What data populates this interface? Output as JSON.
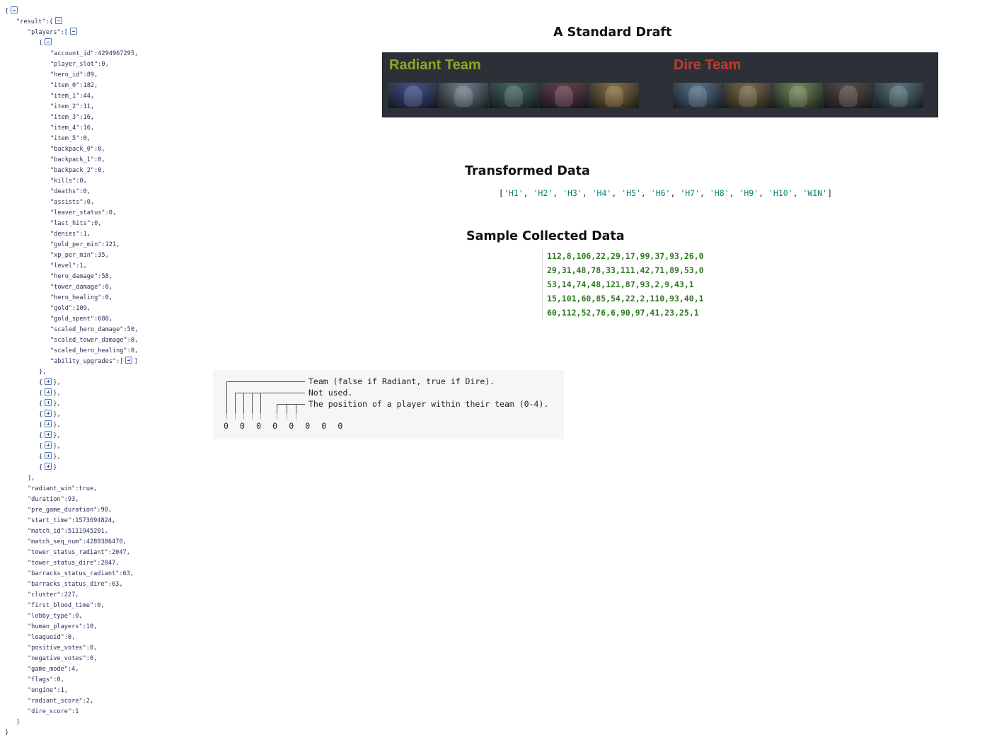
{
  "json_tree": {
    "lines": [
      {
        "indent": 0,
        "text": "{",
        "toggle": "minus"
      },
      {
        "indent": 1,
        "text": "\"result\":{",
        "toggle": "minus"
      },
      {
        "indent": 2,
        "text": "\"players\":[",
        "toggle": "minus"
      },
      {
        "indent": 3,
        "text": "{",
        "toggle": "minus"
      },
      {
        "indent": 4,
        "text": "\"account_id\":4294967295,"
      },
      {
        "indent": 4,
        "text": "\"player_slot\":0,"
      },
      {
        "indent": 4,
        "text": "\"hero_id\":89,"
      },
      {
        "indent": 4,
        "text": "\"item_0\":182,"
      },
      {
        "indent": 4,
        "text": "\"item_1\":44,"
      },
      {
        "indent": 4,
        "text": "\"item_2\":11,"
      },
      {
        "indent": 4,
        "text": "\"item_3\":16,"
      },
      {
        "indent": 4,
        "text": "\"item_4\":16,"
      },
      {
        "indent": 4,
        "text": "\"item_5\":0,"
      },
      {
        "indent": 4,
        "text": "\"backpack_0\":0,"
      },
      {
        "indent": 4,
        "text": "\"backpack_1\":0,"
      },
      {
        "indent": 4,
        "text": "\"backpack_2\":0,"
      },
      {
        "indent": 4,
        "text": "\"kills\":0,"
      },
      {
        "indent": 4,
        "text": "\"deaths\":0,"
      },
      {
        "indent": 4,
        "text": "\"assists\":0,"
      },
      {
        "indent": 4,
        "text": "\"leaver_status\":0,"
      },
      {
        "indent": 4,
        "text": "\"last_hits\":0,"
      },
      {
        "indent": 4,
        "text": "\"denies\":1,"
      },
      {
        "indent": 4,
        "text": "\"gold_per_min\":121,"
      },
      {
        "indent": 4,
        "text": "\"xp_per_min\":35,"
      },
      {
        "indent": 4,
        "text": "\"level\":1,"
      },
      {
        "indent": 4,
        "text": "\"hero_damage\":58,"
      },
      {
        "indent": 4,
        "text": "\"tower_damage\":0,"
      },
      {
        "indent": 4,
        "text": "\"hero_healing\":0,"
      },
      {
        "indent": 4,
        "text": "\"gold\":109,"
      },
      {
        "indent": 4,
        "text": "\"gold_spent\":680,"
      },
      {
        "indent": 4,
        "text": "\"scaled_hero_damage\":50,"
      },
      {
        "indent": 4,
        "text": "\"scaled_tower_damage\":0,"
      },
      {
        "indent": 4,
        "text": "\"scaled_hero_healing\":0,"
      },
      {
        "indent": 4,
        "text": "\"ability_upgrades\":[",
        "toggle": "plus",
        "after": "]"
      },
      {
        "indent": 3,
        "text": "},"
      },
      {
        "indent": 3,
        "text": "{",
        "toggle": "plus",
        "after": "},"
      },
      {
        "indent": 3,
        "text": "{",
        "toggle": "plus",
        "after": "},"
      },
      {
        "indent": 3,
        "text": "{",
        "toggle": "plus",
        "after": "},"
      },
      {
        "indent": 3,
        "text": "{",
        "toggle": "plus",
        "after": "},"
      },
      {
        "indent": 3,
        "text": "{",
        "toggle": "plus",
        "after": "},"
      },
      {
        "indent": 3,
        "text": "{",
        "toggle": "plus",
        "after": "},"
      },
      {
        "indent": 3,
        "text": "{",
        "toggle": "plus",
        "after": "},"
      },
      {
        "indent": 3,
        "text": "{",
        "toggle": "plus",
        "after": "},"
      },
      {
        "indent": 3,
        "text": "{",
        "toggle": "plus",
        "after": "}"
      },
      {
        "indent": 2,
        "text": "],"
      },
      {
        "indent": 2,
        "text": "\"radiant_win\":true,"
      },
      {
        "indent": 2,
        "text": "\"duration\":93,"
      },
      {
        "indent": 2,
        "text": "\"pre_game_duration\":90,"
      },
      {
        "indent": 2,
        "text": "\"start_time\":1573694824,"
      },
      {
        "indent": 2,
        "text": "\"match_id\":5111945201,"
      },
      {
        "indent": 2,
        "text": "\"match_seq_num\":4289306470,"
      },
      {
        "indent": 2,
        "text": "\"tower_status_radiant\":2047,"
      },
      {
        "indent": 2,
        "text": "\"tower_status_dire\":2047,"
      },
      {
        "indent": 2,
        "text": "\"barracks_status_radiant\":63,"
      },
      {
        "indent": 2,
        "text": "\"barracks_status_dire\":63,"
      },
      {
        "indent": 2,
        "text": "\"cluster\":227,"
      },
      {
        "indent": 2,
        "text": "\"first_blood_time\":0,"
      },
      {
        "indent": 2,
        "text": "\"lobby_type\":0,"
      },
      {
        "indent": 2,
        "text": "\"human_players\":10,"
      },
      {
        "indent": 2,
        "text": "\"leagueid\":0,"
      },
      {
        "indent": 2,
        "text": "\"positive_votes\":0,"
      },
      {
        "indent": 2,
        "text": "\"negative_votes\":0,"
      },
      {
        "indent": 2,
        "text": "\"game_mode\":4,"
      },
      {
        "indent": 2,
        "text": "\"flags\":0,"
      },
      {
        "indent": 2,
        "text": "\"engine\":1,"
      },
      {
        "indent": 2,
        "text": "\"radiant_score\":2,"
      },
      {
        "indent": 2,
        "text": "\"dire_score\":1"
      },
      {
        "indent": 1,
        "text": "}"
      },
      {
        "indent": 0,
        "text": "}"
      }
    ]
  },
  "draft": {
    "title": "A Standard Draft",
    "radiant_label": "Radiant Team",
    "dire_label": "Dire Team",
    "colors": {
      "panel": "#2c3138",
      "radiant": "#92a525",
      "dire": "#c23c2a"
    },
    "radiant_heroes": [
      {
        "icon": "blue-hero-portrait-icon",
        "color": "#2d3f8c"
      },
      {
        "icon": "ghostly-hero-portrait-icon",
        "color": "#6b7f8f"
      },
      {
        "icon": "winged-hero-portrait-icon",
        "color": "#2f5d56"
      },
      {
        "icon": "fiery-hero-portrait-icon",
        "color": "#5a2a3a"
      },
      {
        "icon": "beast-hero-portrait-icon",
        "color": "#8a6a2b"
      }
    ],
    "dire_heroes": [
      {
        "icon": "dragon-hero-portrait-icon",
        "color": "#4a6d8c"
      },
      {
        "icon": "bearded-hero-portrait-icon",
        "color": "#7a6233"
      },
      {
        "icon": "ogre-hero-portrait-icon",
        "color": "#6f8a4a"
      },
      {
        "icon": "bear-hero-portrait-icon",
        "color": "#4b3a33"
      },
      {
        "icon": "tidehunter-hero-portrait-icon",
        "color": "#4a6e7a"
      }
    ]
  },
  "transformed": {
    "title": "Transformed Data",
    "open": "[",
    "close": "]",
    "items": [
      "'H1'",
      "'H2'",
      "'H3'",
      "'H4'",
      "'H5'",
      "'H6'",
      "'H7'",
      "'H8'",
      "'H9'",
      "'H10'",
      "'WIN'"
    ]
  },
  "sample": {
    "title": "Sample Collected Data",
    "rows": [
      "112,8,106,22,29,17,99,37,93,26,0",
      "29,31,48,78,33,111,42,71,89,53,0",
      "53,14,74,48,121,87,93,2,9,43,1",
      "15,101,60,85,54,22,2,110,93,40,1",
      "60,112,52,76,6,90,97,41,23,25,1"
    ]
  },
  "diagram": {
    "bits": "0 0 0 0 0 0 0 0",
    "team_label": "Team (false if Radiant, true if Dire).",
    "not_used_label": "Not used.",
    "position_label": "The position of a player within their team (0-4)."
  }
}
